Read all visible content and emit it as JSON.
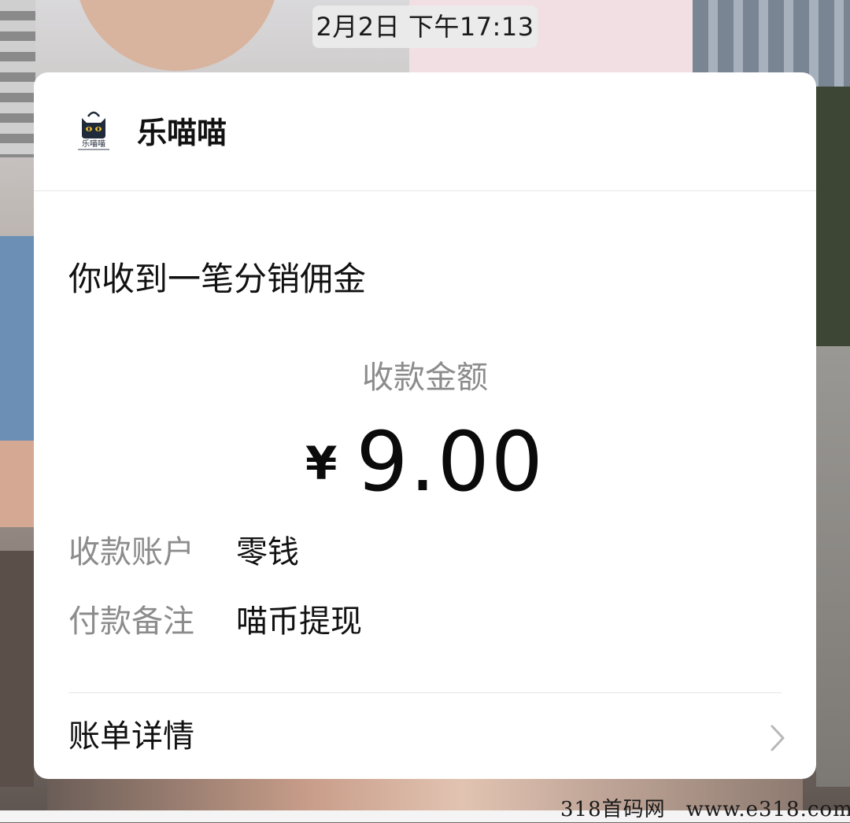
{
  "status": {
    "timestamp": "2月2日 下午17:13"
  },
  "card": {
    "app_name": "乐喵喵",
    "logo_text": "乐喵喵",
    "logo_icon": "cat-shopping-bag-logo",
    "title": "你收到一笔分销佣金",
    "amount_label": "收款金额",
    "currency": "¥",
    "amount": "9.00",
    "details": [
      {
        "label": "收款账户",
        "value": "零钱"
      },
      {
        "label": "付款备注",
        "value": "喵币提现"
      }
    ],
    "bill_link": {
      "label": "账单详情",
      "icon": "chevron-right-icon"
    }
  },
  "watermark": {
    "site_name": "318首码网",
    "site_url": "www.e318.com"
  },
  "colors": {
    "card_bg": "#ffffff",
    "primary_text": "#111111",
    "secondary_text": "#8c8c8c",
    "divider": "#e6e6e6",
    "timestamp_bg": "#ececec"
  }
}
